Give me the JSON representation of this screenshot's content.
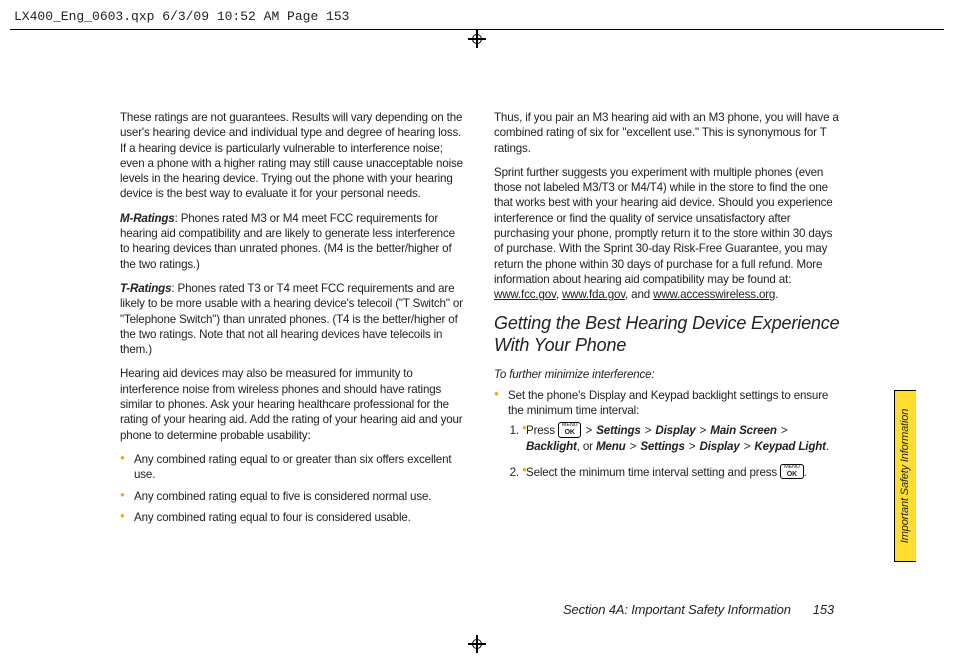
{
  "slug": "LX400_Eng_0603.qxp  6/3/09  10:52 AM  Page 153",
  "left": {
    "p1": "These ratings are not guarantees. Results will vary depending on the user's hearing device and individual type and degree of hearing loss. If a hearing device is particularly vulnerable to interference noise; even a phone with a higher rating may still cause unacceptable noise levels in the hearing device. Trying out the phone with your hearing device is the best way to evaluate it for your personal needs.",
    "m_label": "M-Ratings",
    "m_body": ": Phones rated M3 or M4 meet FCC requirements for hearing aid compatibility and are likely to generate less interference to hearing devices than unrated phones. (M4 is the better/higher of the two ratings.)",
    "t_label": "T-Ratings",
    "t_body": ": Phones rated T3 or T4 meet FCC requirements and are likely to be more usable with a hearing device's telecoil (\"T Switch\" or \"Telephone Switch\") than unrated phones. (T4 is the better/higher of the two ratings. Note that not all hearing devices have telecoils in them.)",
    "p2": "Hearing aid devices may also be measured for immunity to interference noise from wireless phones and should have ratings similar to phones. Ask your hearing healthcare professional for the rating of your hearing aid. Add the rating of your hearing aid and your phone to determine probable usability:",
    "b1": "Any combined rating equal to or greater than six offers excellent use.",
    "b2": "Any combined rating equal to five is considered normal use.",
    "b3": "Any combined rating equal to four is considered usable."
  },
  "right": {
    "p1": "Thus, if you pair an M3 hearing aid with an M3 phone, you will have a combined rating of six for \"excellent use.\" This is synonymous for T ratings.",
    "p2a": "Sprint further suggests you experiment with multiple phones (even those not labeled M3/T3 or M4/T4) while in the store to find the one that works best with your hearing aid device. Should you experience interference or find the quality of service unsatisfactory after purchasing your phone, promptly return it to the store within 30 days of purchase. With the Sprint 30-day Risk-Free Guarantee, you may return the phone within 30 days of purchase for a full refund. More information about hearing aid compatibility may be found at: ",
    "link1": "www.fcc.gov",
    "link2": "www.fda.gov",
    "and": ", and ",
    "link3": "www.accesswireless.org",
    "heading": "Getting the Best Hearing Device Experience With Your Phone",
    "lead": "To further minimize interference:",
    "bullet": "Set the phone's Display and Keypad backlight settings to ensure the minimum time interval:",
    "step1_pre": "Press  ",
    "key_top": "MENU",
    "key_main": "OK",
    "nav1": "Settings",
    "nav2": "Display",
    "nav3": "Main Screen",
    "nav4": "Backlight",
    "or": ", or ",
    "nav5": "Menu",
    "nav6": "Settings",
    "nav7": "Display",
    "nav8": "Keypad Light",
    "step2": "Select the minimum time interval setting and press "
  },
  "footer": {
    "section": "Section 4A: Important Safety Information",
    "page": "153"
  },
  "sidetab": "Important Safety Information"
}
